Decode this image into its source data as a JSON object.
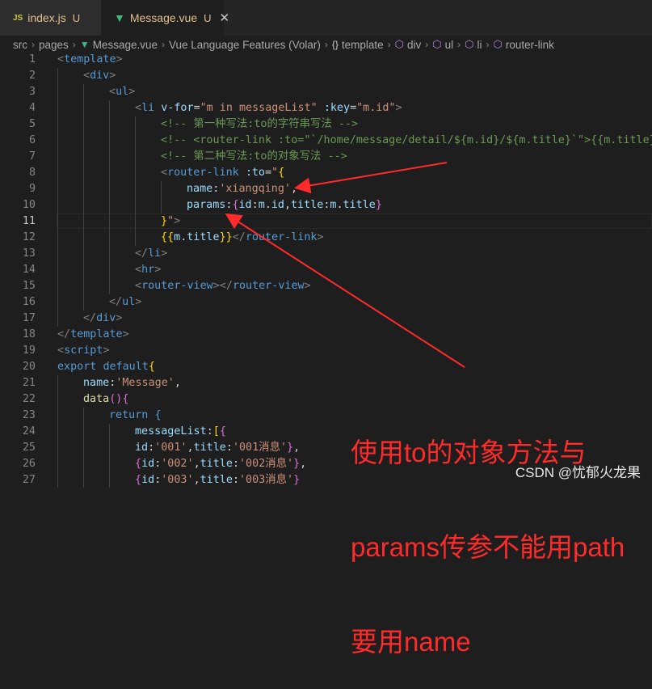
{
  "tabs": [
    {
      "icon": "JS",
      "name": "index.js",
      "status": "U"
    },
    {
      "icon": "vue",
      "name": "Message.vue",
      "status": "U",
      "close": "✕"
    }
  ],
  "breadcrumb": [
    {
      "label": "src",
      "icon": ""
    },
    {
      "label": "pages",
      "icon": ""
    },
    {
      "label": "Message.vue",
      "icon": "vue"
    },
    {
      "label": "Vue Language Features (Volar)",
      "icon": ""
    },
    {
      "label": "template",
      "icon": "braces"
    },
    {
      "label": "div",
      "icon": "cube"
    },
    {
      "label": "ul",
      "icon": "cube"
    },
    {
      "label": "li",
      "icon": "cube"
    },
    {
      "label": "router-link",
      "icon": "cube"
    }
  ],
  "current_line": 11,
  "code_lines": [
    {
      "n": "1",
      "indent": 0,
      "tokens": [
        [
          "t-punct",
          "<"
        ],
        [
          "t-tag",
          "template"
        ],
        [
          "t-punct",
          ">"
        ]
      ]
    },
    {
      "n": "2",
      "indent": 1,
      "tokens": [
        [
          "t-punct",
          "<"
        ],
        [
          "t-tag",
          "div"
        ],
        [
          "t-punct",
          ">"
        ]
      ]
    },
    {
      "n": "3",
      "indent": 2,
      "tokens": [
        [
          "t-punct",
          "<"
        ],
        [
          "t-tag",
          "ul"
        ],
        [
          "t-punct",
          ">"
        ]
      ]
    },
    {
      "n": "4",
      "indent": 3,
      "tokens": [
        [
          "t-punct",
          "<"
        ],
        [
          "t-tag",
          "li"
        ],
        [
          "t-default",
          " "
        ],
        [
          "t-attr",
          "v-for"
        ],
        [
          "t-default",
          "="
        ],
        [
          "t-str",
          "\"m in messageList\""
        ],
        [
          "t-default",
          " "
        ],
        [
          "t-attr",
          ":key"
        ],
        [
          "t-default",
          "="
        ],
        [
          "t-str",
          "\"m.id\""
        ],
        [
          "t-punct",
          ">"
        ]
      ]
    },
    {
      "n": "5",
      "indent": 4,
      "tokens": [
        [
          "t-comment",
          "<!-- 第一种写法:to的字符串写法 -->"
        ]
      ]
    },
    {
      "n": "6",
      "indent": 4,
      "tokens": [
        [
          "t-comment",
          "<!-- <router-link :to=\"`/home/message/detail/${m.id}/${m.title}`\">{{m.title}}</router-link> -->"
        ]
      ]
    },
    {
      "n": "7",
      "indent": 4,
      "tokens": [
        [
          "t-comment",
          "<!-- 第二种写法:to的对象写法 -->"
        ]
      ]
    },
    {
      "n": "8",
      "indent": 4,
      "tokens": [
        [
          "t-punct",
          "<"
        ],
        [
          "t-tag",
          "router-link"
        ],
        [
          "t-default",
          " "
        ],
        [
          "t-attr",
          ":to"
        ],
        [
          "t-default",
          "="
        ],
        [
          "t-str",
          "\""
        ],
        [
          "t-brace",
          "{"
        ]
      ]
    },
    {
      "n": "9",
      "indent": 5,
      "tokens": [
        [
          "t-key",
          "name"
        ],
        [
          "t-default",
          ":"
        ],
        [
          "t-str",
          "'xiangqing'"
        ],
        [
          "t-default",
          ","
        ]
      ]
    },
    {
      "n": "10",
      "indent": 5,
      "tokens": [
        [
          "t-key",
          "params"
        ],
        [
          "t-default",
          ":"
        ],
        [
          "t-brace2",
          "{"
        ],
        [
          "t-key",
          "id"
        ],
        [
          "t-default",
          ":"
        ],
        [
          "t-prop",
          "m"
        ],
        [
          "t-default",
          "."
        ],
        [
          "t-prop",
          "id"
        ],
        [
          "t-default",
          ","
        ],
        [
          "t-key",
          "title"
        ],
        [
          "t-default",
          ":"
        ],
        [
          "t-prop",
          "m"
        ],
        [
          "t-default",
          "."
        ],
        [
          "t-prop",
          "title"
        ],
        [
          "t-brace2",
          "}"
        ]
      ]
    },
    {
      "n": "11",
      "indent": 4,
      "tokens": [
        [
          "t-brace",
          "}"
        ],
        [
          "t-str",
          "\""
        ],
        [
          "t-punct",
          ">"
        ]
      ]
    },
    {
      "n": "12",
      "indent": 4,
      "tokens": [
        [
          "t-brace",
          "{{"
        ],
        [
          "t-prop",
          "m"
        ],
        [
          "t-default",
          "."
        ],
        [
          "t-prop",
          "title"
        ],
        [
          "t-brace",
          "}}"
        ],
        [
          "t-punct",
          "</"
        ],
        [
          "t-tag",
          "router-link"
        ],
        [
          "t-punct",
          ">"
        ]
      ]
    },
    {
      "n": "13",
      "indent": 3,
      "tokens": [
        [
          "t-punct",
          "</"
        ],
        [
          "t-tag",
          "li"
        ],
        [
          "t-punct",
          ">"
        ]
      ]
    },
    {
      "n": "14",
      "indent": 3,
      "tokens": [
        [
          "t-punct",
          "<"
        ],
        [
          "t-tag",
          "hr"
        ],
        [
          "t-punct",
          ">"
        ]
      ]
    },
    {
      "n": "15",
      "indent": 3,
      "tokens": [
        [
          "t-punct",
          "<"
        ],
        [
          "t-tag",
          "router-view"
        ],
        [
          "t-punct",
          "></"
        ],
        [
          "t-tag",
          "router-view"
        ],
        [
          "t-punct",
          ">"
        ]
      ]
    },
    {
      "n": "16",
      "indent": 2,
      "tokens": [
        [
          "t-punct",
          "</"
        ],
        [
          "t-tag",
          "ul"
        ],
        [
          "t-punct",
          ">"
        ]
      ]
    },
    {
      "n": "17",
      "indent": 1,
      "tokens": [
        [
          "t-punct",
          "</"
        ],
        [
          "t-tag",
          "div"
        ],
        [
          "t-punct",
          ">"
        ]
      ]
    },
    {
      "n": "18",
      "indent": 0,
      "tokens": [
        [
          "t-punct",
          "</"
        ],
        [
          "t-tag",
          "template"
        ],
        [
          "t-punct",
          ">"
        ]
      ]
    },
    {
      "n": "19",
      "indent": 0,
      "tokens": [
        [
          "t-punct",
          "<"
        ],
        [
          "t-tag",
          "script"
        ],
        [
          "t-punct",
          ">"
        ]
      ]
    },
    {
      "n": "20",
      "indent": 0,
      "tokens": [
        [
          "t-keyword",
          "export"
        ],
        [
          "t-default",
          " "
        ],
        [
          "t-keyword",
          "default"
        ],
        [
          "t-brace",
          "{"
        ]
      ]
    },
    {
      "n": "21",
      "indent": 1,
      "tokens": [
        [
          "t-key",
          "name"
        ],
        [
          "t-default",
          ":"
        ],
        [
          "t-str",
          "'Message'"
        ],
        [
          "t-default",
          ","
        ]
      ]
    },
    {
      "n": "22",
      "indent": 1,
      "tokens": [
        [
          "t-func",
          "data"
        ],
        [
          "t-brace2",
          "()"
        ],
        [
          "t-brace2",
          "{"
        ]
      ]
    },
    {
      "n": "23",
      "indent": 2,
      "tokens": [
        [
          "t-keyword",
          "return"
        ],
        [
          "t-default",
          " "
        ],
        [
          "t-keyword",
          "{"
        ]
      ]
    },
    {
      "n": "24",
      "indent": 3,
      "tokens": [
        [
          "t-key",
          "messageList"
        ],
        [
          "t-default",
          ":"
        ],
        [
          "t-brace",
          "["
        ],
        [
          "t-brace2",
          "{"
        ]
      ]
    },
    {
      "n": "25",
      "indent": 3,
      "tokens": [
        [
          "t-key",
          "id"
        ],
        [
          "t-default",
          ":"
        ],
        [
          "t-str",
          "'001'"
        ],
        [
          "t-default",
          ","
        ],
        [
          "t-key",
          "title"
        ],
        [
          "t-default",
          ":"
        ],
        [
          "t-str",
          "'001消息'"
        ],
        [
          "t-brace2",
          "}"
        ],
        [
          "t-default",
          ","
        ]
      ]
    },
    {
      "n": "26",
      "indent": 3,
      "tokens": [
        [
          "t-brace2",
          "{"
        ],
        [
          "t-key",
          "id"
        ],
        [
          "t-default",
          ":"
        ],
        [
          "t-str",
          "'002'"
        ],
        [
          "t-default",
          ","
        ],
        [
          "t-key",
          "title"
        ],
        [
          "t-default",
          ":"
        ],
        [
          "t-str",
          "'002消息'"
        ],
        [
          "t-brace2",
          "}"
        ],
        [
          "t-default",
          ","
        ]
      ]
    },
    {
      "n": "27",
      "indent": 3,
      "tokens": [
        [
          "t-brace2",
          "{"
        ],
        [
          "t-key",
          "id"
        ],
        [
          "t-default",
          ":"
        ],
        [
          "t-str",
          "'003'"
        ],
        [
          "t-default",
          ","
        ],
        [
          "t-key",
          "title"
        ],
        [
          "t-default",
          ":"
        ],
        [
          "t-str",
          "'003消息'"
        ],
        [
          "t-brace2",
          "}"
        ]
      ]
    }
  ],
  "annotation": {
    "lines": [
      "使用to的对象方法与",
      "params传参不能用path",
      "要用name"
    ]
  },
  "watermark": "CSDN @忧郁火龙果",
  "colors": {
    "annotation": "#ff2b2b",
    "accent": "#41b883"
  }
}
